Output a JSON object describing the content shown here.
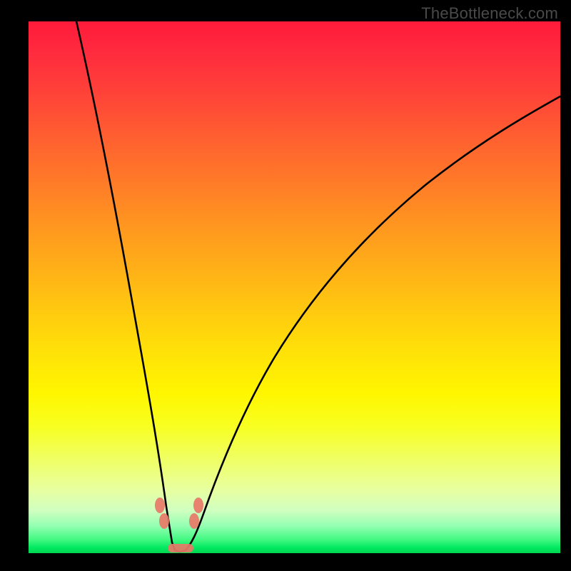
{
  "watermark": "TheBottleneck.com",
  "chart_data": {
    "type": "line",
    "title": "",
    "xlabel": "",
    "ylabel": "",
    "xlim": [
      0,
      100
    ],
    "ylim": [
      0,
      100
    ],
    "grid": false,
    "series": [
      {
        "name": "left-curve",
        "x": [
          9,
          11,
          13,
          15,
          17,
          19,
          21,
          23,
          24,
          25,
          25.5,
          26,
          27,
          28
        ],
        "values": [
          100,
          88,
          76,
          64,
          52,
          40,
          28,
          16,
          10,
          5,
          2,
          0,
          0,
          0
        ]
      },
      {
        "name": "right-curve",
        "x": [
          28,
          29,
          30,
          31,
          33,
          36,
          40,
          46,
          54,
          64,
          76,
          90,
          100
        ],
        "values": [
          0,
          0,
          2,
          5,
          12,
          22,
          33,
          45,
          56,
          66,
          75,
          82,
          86
        ]
      }
    ],
    "markers": [
      {
        "name": "left-top-blob",
        "x": 24.3,
        "y": 8.5
      },
      {
        "name": "left-bottom-blob",
        "x": 25.2,
        "y": 5.0
      },
      {
        "name": "right-top-blob",
        "x": 31.7,
        "y": 8.5
      },
      {
        "name": "right-bottom-blob",
        "x": 30.8,
        "y": 5.0
      },
      {
        "name": "valley-blob",
        "x": 27.5,
        "y": 1.0
      }
    ],
    "background_gradient": {
      "top": "#ff1b3a",
      "mid": "#fff600",
      "bottom": "#00d850"
    }
  }
}
